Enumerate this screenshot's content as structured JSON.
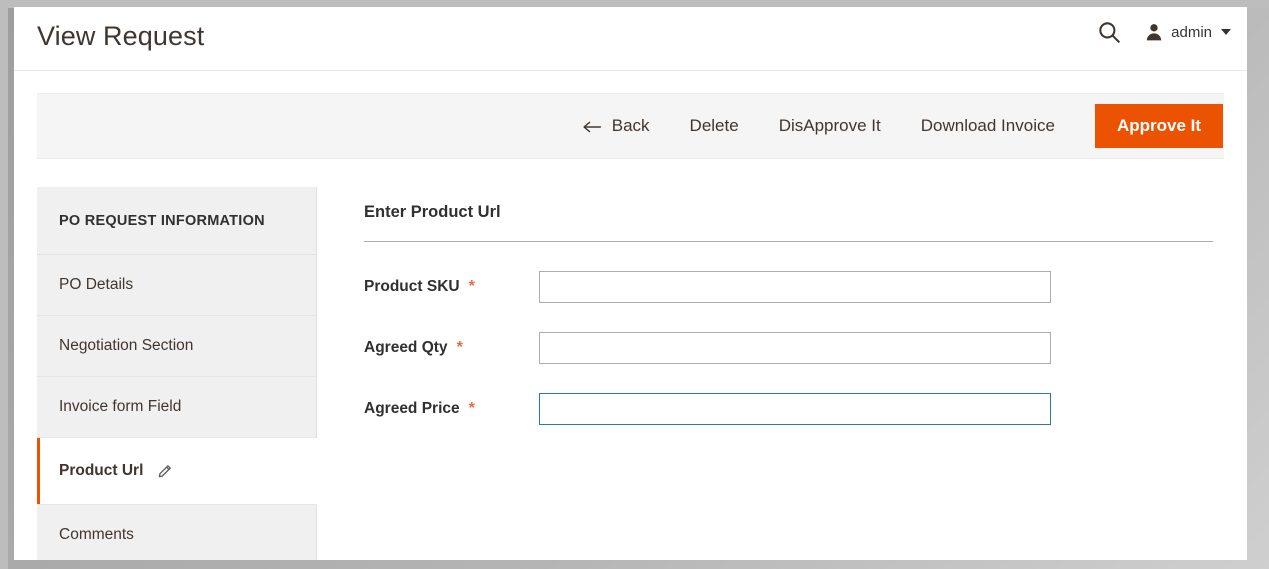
{
  "header": {
    "title": "View Request",
    "search_icon": "search-icon",
    "user": {
      "avatar_icon": "user-avatar-icon",
      "name": "admin",
      "caret_icon": "chevron-down-icon"
    }
  },
  "toolbar": {
    "back_icon": "arrow-left-icon",
    "back_label": "Back",
    "delete_label": "Delete",
    "disapprove_label": "DisApprove It",
    "download_invoice_label": "Download Invoice",
    "approve_label": "Approve It",
    "primary_color": "#eb5202"
  },
  "sidebar": {
    "title": "PO REQUEST INFORMATION",
    "active_index": 3,
    "active_accent_color": "#eb5202",
    "items": [
      {
        "label": "PO Details",
        "active": false
      },
      {
        "label": "Negotiation Section",
        "active": false
      },
      {
        "label": "Invoice form Field",
        "active": false
      },
      {
        "label": "Product Url",
        "active": true,
        "icon": "pencil-icon"
      },
      {
        "label": "Comments",
        "active": false
      }
    ]
  },
  "form": {
    "legend": "Enter Product Url",
    "required_symbol": "*",
    "focus_color": "#2a7ab0",
    "fields": [
      {
        "label": "Product SKU",
        "required": true,
        "value": "",
        "placeholder": "",
        "focused": false
      },
      {
        "label": "Agreed Qty",
        "required": true,
        "value": "",
        "placeholder": "",
        "focused": false
      },
      {
        "label": "Agreed Price",
        "required": true,
        "value": "",
        "placeholder": "",
        "focused": true
      }
    ]
  }
}
